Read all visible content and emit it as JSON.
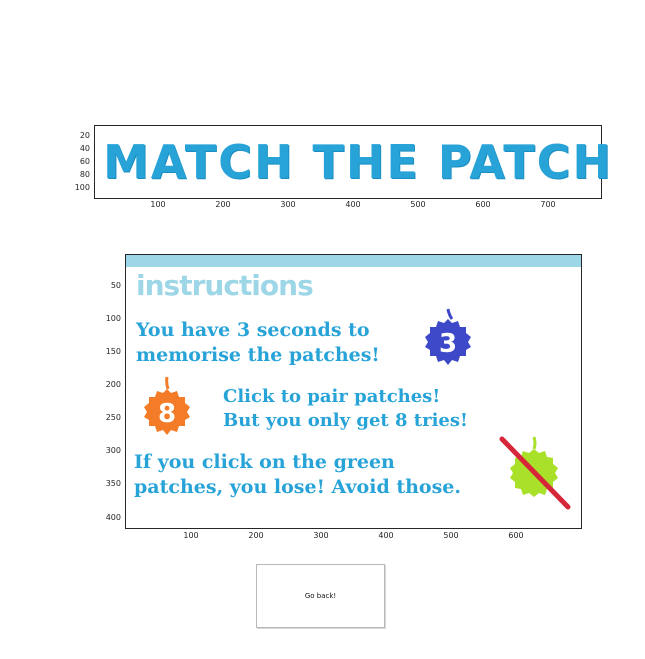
{
  "title_plot": {
    "title_text": "MATCH THE PATCH",
    "y_ticks": [
      "20",
      "40",
      "60",
      "80",
      "100"
    ],
    "x_ticks": [
      "100",
      "200",
      "300",
      "400",
      "500",
      "600",
      "700"
    ]
  },
  "instructions_plot": {
    "heading": "instructions",
    "lines": [
      "You have 3 seconds to",
      "memorise the patches!",
      "Click to pair patches!",
      "But you only get 8 tries!",
      "If you click on the green",
      "patches, you lose! Avoid those."
    ],
    "badge_three": "3",
    "badge_eight": "8",
    "y_ticks": [
      "50",
      "100",
      "150",
      "200",
      "250",
      "300",
      "350",
      "400"
    ],
    "x_ticks": [
      "100",
      "200",
      "300",
      "400",
      "500",
      "600"
    ]
  },
  "back_button_label": "Go back!",
  "colors": {
    "title_blue": "#27a3d8",
    "band_blue": "#9dd6e7",
    "badge_purple": "#3e49c9",
    "badge_orange": "#f47b27",
    "badge_green": "#a8e02a",
    "strike_red": "#d6263a"
  },
  "icons": [
    "badge-three-icon",
    "badge-eight-icon",
    "green-patch-forbidden-icon"
  ]
}
